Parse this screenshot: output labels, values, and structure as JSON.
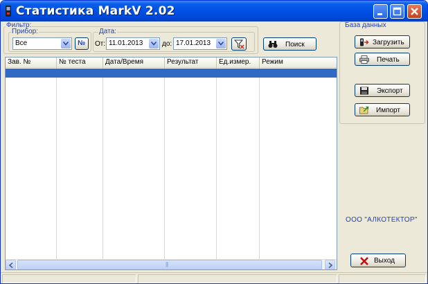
{
  "window": {
    "title": "Статистика MarkV 2.02"
  },
  "filter": {
    "legend": "Фильтр:",
    "device": {
      "legend": "Прибор:",
      "selected": "Все",
      "number_button": "№"
    },
    "date": {
      "legend": "Дата:",
      "from_label": "От:",
      "from_value": "11.01.2013",
      "to_label": "до:",
      "to_value": "17.01.2013"
    }
  },
  "search": {
    "label": "Поиск"
  },
  "table": {
    "columns": [
      "Зав. №",
      "№ теста",
      "Дата/Время",
      "Результат",
      "Ед.измер.",
      "Режим"
    ],
    "rows": [],
    "scroll_thumb_glyph": "|||"
  },
  "database": {
    "legend": "База данных",
    "load": "Загрузить",
    "print": "Печать",
    "export": "Экспорт",
    "import": "Импорт"
  },
  "company": "ООО \"АЛКОТЕКТОР\"",
  "exit": "Выход",
  "colors": {
    "title_bar": "#0050e6",
    "selection": "#316ac5",
    "legend_text": "#1f3fb0",
    "close_button": "#c4401c"
  }
}
